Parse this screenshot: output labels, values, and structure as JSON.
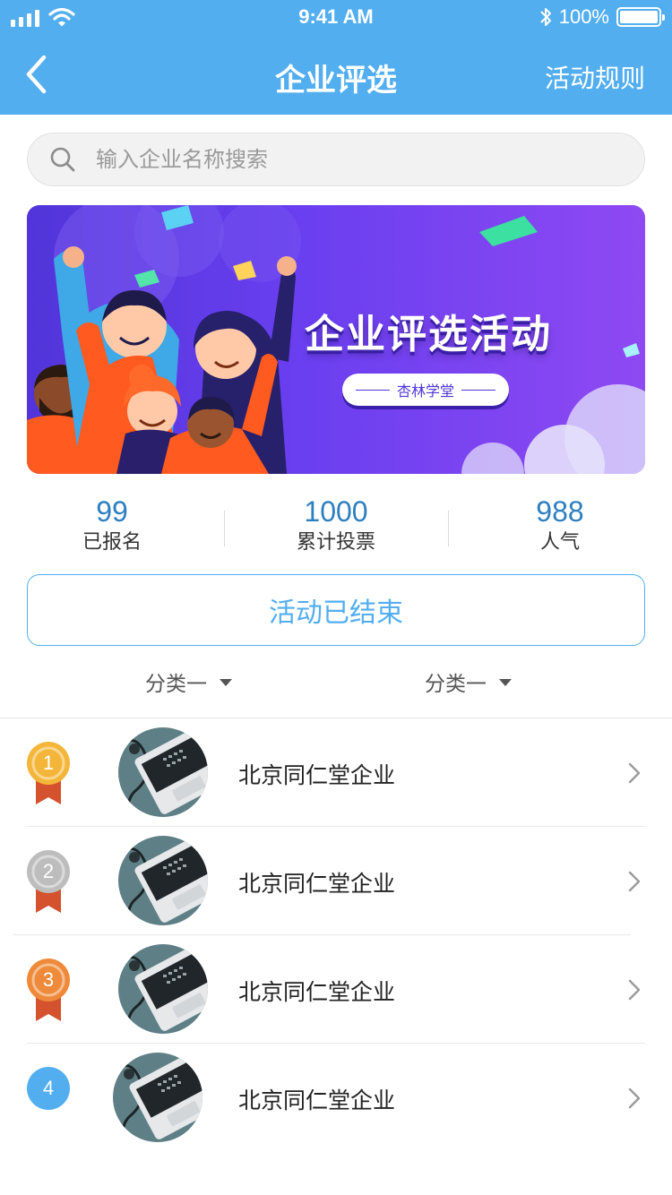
{
  "status_bar": {
    "time": "9:41 AM",
    "battery_text": "100%",
    "battery_level": 1.0
  },
  "nav": {
    "title": "企业评选",
    "right_action": "活动规则"
  },
  "search": {
    "placeholder": "输入企业名称搜索"
  },
  "banner": {
    "title": "企业评选活动",
    "subtitle": "杏林学堂"
  },
  "stats": [
    {
      "value": "99",
      "label": "已报名"
    },
    {
      "value": "1000",
      "label": "累计投票"
    },
    {
      "value": "988",
      "label": "人气"
    }
  ],
  "status_button": "活动已结束",
  "filters": [
    "分类一",
    "分类一"
  ],
  "colors": {
    "primary": "#52AEEF",
    "stat_value": "#2E7FC0",
    "rank_gold": "#F4B63A",
    "rank_silver": "#BDBDBD",
    "rank_bronze": "#EE8A3A",
    "rank_default": "#52AEEF",
    "ribbon": "#D4522E"
  },
  "list": [
    {
      "rank": "1",
      "name": "北京同仁堂企业",
      "medal": "gold"
    },
    {
      "rank": "2",
      "name": "北京同仁堂企业",
      "medal": "silver"
    },
    {
      "rank": "3",
      "name": "北京同仁堂企业",
      "medal": "bronze"
    },
    {
      "rank": "4",
      "name": "北京同仁堂企业",
      "medal": "none"
    }
  ]
}
